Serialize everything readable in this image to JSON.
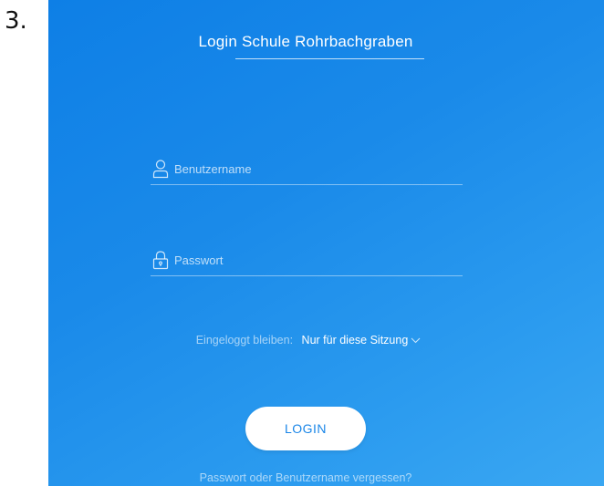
{
  "step": {
    "number": "3."
  },
  "login": {
    "title": "Login Schule Rohrbachgraben",
    "username": {
      "placeholder": "Benutzername",
      "value": "",
      "icon": "user-icon"
    },
    "password": {
      "placeholder": "Passwort",
      "value": "",
      "icon": "lock-icon"
    },
    "stay_logged_in": {
      "label": "Eingeloggt bleiben:",
      "selected": "Nur für diese Sitzung",
      "icon": "chevron-down-icon"
    },
    "button_label": "LOGIN",
    "forgot_link": "Passwort oder Benutzername vergessen?"
  },
  "colors": {
    "background_start": "#0e7fe6",
    "background_end": "#3aa7f2",
    "button_bg": "#ffffff",
    "button_text": "#1a86e8"
  }
}
